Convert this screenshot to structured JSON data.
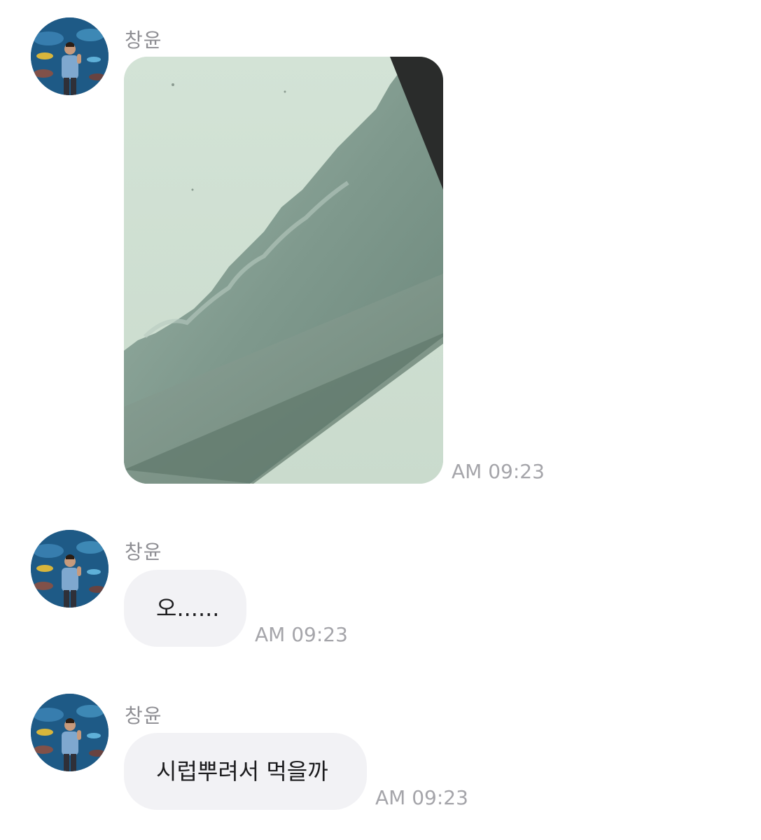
{
  "messages": [
    {
      "sender": "창윤",
      "type": "image",
      "image_description": "snow piled on a railing against a pale sky",
      "time": "AM 09:23"
    },
    {
      "sender": "창윤",
      "type": "text",
      "text": "오......",
      "time": "AM 09:23"
    },
    {
      "sender": "창윤",
      "type": "text",
      "text": "시럽뿌려서 먹을까",
      "time": "AM 09:23"
    }
  ],
  "colors": {
    "sender_text": "#8e8e93",
    "bubble_bg": "#f2f2f5",
    "timestamp_text": "#a5a5aa",
    "message_text": "#1c1c1e"
  },
  "icons": {
    "avatar": "profile-photo-aquarium"
  }
}
